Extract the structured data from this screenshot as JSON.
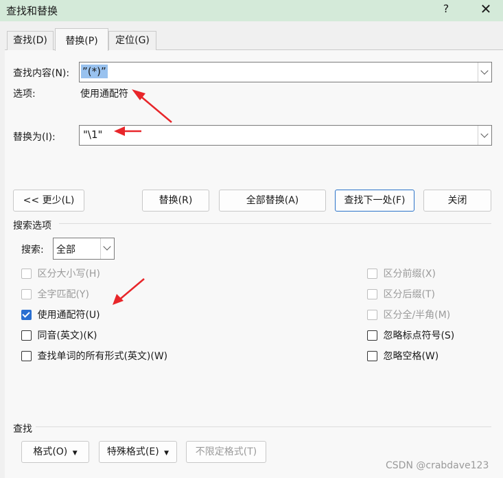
{
  "window": {
    "title": "查找和替换",
    "help": "?",
    "close": "✕"
  },
  "tabs": [
    {
      "label": "查找(D)"
    },
    {
      "label": "替换(P)"
    },
    {
      "label": "定位(G)"
    }
  ],
  "find": {
    "label": "查找内容(N):",
    "value": "”(*)”"
  },
  "options": {
    "label": "选项:",
    "value": "使用通配符"
  },
  "replace": {
    "label": "替换为(I):",
    "value": "\"\\1\""
  },
  "buttons": {
    "less": "<< 更少(L)",
    "replace": "替换(R)",
    "replace_all": "全部替换(A)",
    "find_next": "查找下一处(F)",
    "close": "关闭"
  },
  "search_options": {
    "heading": "搜索选项",
    "search_label": "搜索:",
    "search_value": "全部"
  },
  "checks_left": [
    {
      "label": "区分大小写(H)",
      "checked": false,
      "disabled": true
    },
    {
      "label": "全字匹配(Y)",
      "checked": false,
      "disabled": true
    },
    {
      "label": "使用通配符(U)",
      "checked": true,
      "disabled": false
    },
    {
      "label": "同音(英文)(K)",
      "checked": false,
      "disabled": false
    },
    {
      "label": "查找单词的所有形式(英文)(W)",
      "checked": false,
      "disabled": false
    }
  ],
  "checks_right": [
    {
      "label": "区分前缀(X)",
      "checked": false,
      "disabled": true
    },
    {
      "label": "区分后缀(T)",
      "checked": false,
      "disabled": true
    },
    {
      "label": "区分全/半角(M)",
      "checked": false,
      "disabled": true
    },
    {
      "label": "忽略标点符号(S)",
      "checked": false,
      "disabled": false
    },
    {
      "label": "忽略空格(W)",
      "checked": false,
      "disabled": false
    }
  ],
  "find_section": {
    "heading": "查找",
    "format": "格式(O)",
    "special": "特殊格式(E)",
    "no_format": "不限定格式(T)"
  },
  "watermark": "CSDN @crabdave123",
  "colors": {
    "titlebar": "#d4ead9",
    "accent": "#2a6fd1",
    "arrow": "#e8262a"
  }
}
